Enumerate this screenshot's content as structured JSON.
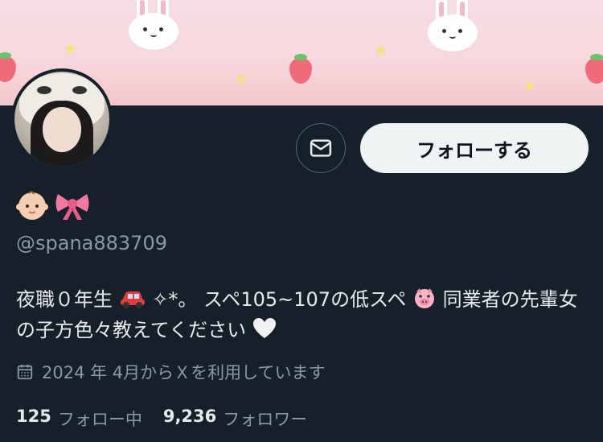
{
  "profile": {
    "display_name_emojis": [
      "baby",
      "ribbon"
    ],
    "handle": "@spana883709",
    "bio": {
      "part1": "夜職０年生",
      "part2": "✧*。 スペ105~107の低スペ",
      "part3": " 同業者の先輩女の子方色々教えてください"
    },
    "joined": "2024 年 4月からＸを利用しています",
    "following_count": "125",
    "following_label": "フォロー中",
    "followers_count": "9,236",
    "followers_label": "フォロワー"
  },
  "actions": {
    "follow_label": "フォローする",
    "message_icon": "mail-icon"
  },
  "colors": {
    "background": "#15202b",
    "follow_button_bg": "#eff3f4",
    "secondary_text": "#8b98a5",
    "banner_pink": "#f6dde4"
  }
}
